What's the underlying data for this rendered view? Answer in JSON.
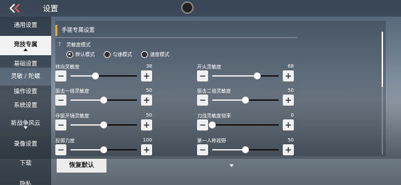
{
  "header": {
    "title": "设置"
  },
  "sidebar": {
    "items": [
      {
        "label": "通用设置"
      },
      {
        "label": "竞技专属"
      },
      {
        "label": "基础设置"
      },
      {
        "label": "灵敏 / 陀螺"
      },
      {
        "label": "操作设置"
      },
      {
        "label": "系统设置"
      },
      {
        "label": "新战争风云"
      },
      {
        "label": "录像设置"
      },
      {
        "label": "下载"
      },
      {
        "label": "隐私"
      }
    ]
  },
  "section": {
    "title": "手搓专属设置",
    "help": "?",
    "mode_label": "灵敏度模式",
    "modes": [
      {
        "label": "默认模式",
        "selected": true
      },
      {
        "label": "匀速模式",
        "selected": false
      },
      {
        "label": "速度模式",
        "selected": false
      }
    ]
  },
  "sliders": [
    {
      "label": "转向灵敏度",
      "value": "38",
      "level": 0.38
    },
    {
      "label": "开火灵敏度",
      "value": "68",
      "level": 0.68
    },
    {
      "label": "狙击一倍灵敏度",
      "value": "50",
      "level": 0.5
    },
    {
      "label": "狙击二倍灵敏度",
      "value": "50",
      "level": 0.5
    },
    {
      "label": "非狙开镜灵敏度",
      "value": "50",
      "level": 0.5
    },
    {
      "label": "刀战灵敏度倍率",
      "value": "0",
      "level": 0.0
    },
    {
      "label": "投掷力度",
      "value": "100",
      "level": 0.5
    },
    {
      "label": "第一人称视野",
      "value": "50",
      "level": 0.5
    }
  ],
  "footer": {
    "restore_label": "恢复默认"
  },
  "icons": {
    "back": "back-chevron-icon",
    "help": "help-icon",
    "avatar": "avatar"
  },
  "colors": {
    "accent": "#e6a23c"
  }
}
